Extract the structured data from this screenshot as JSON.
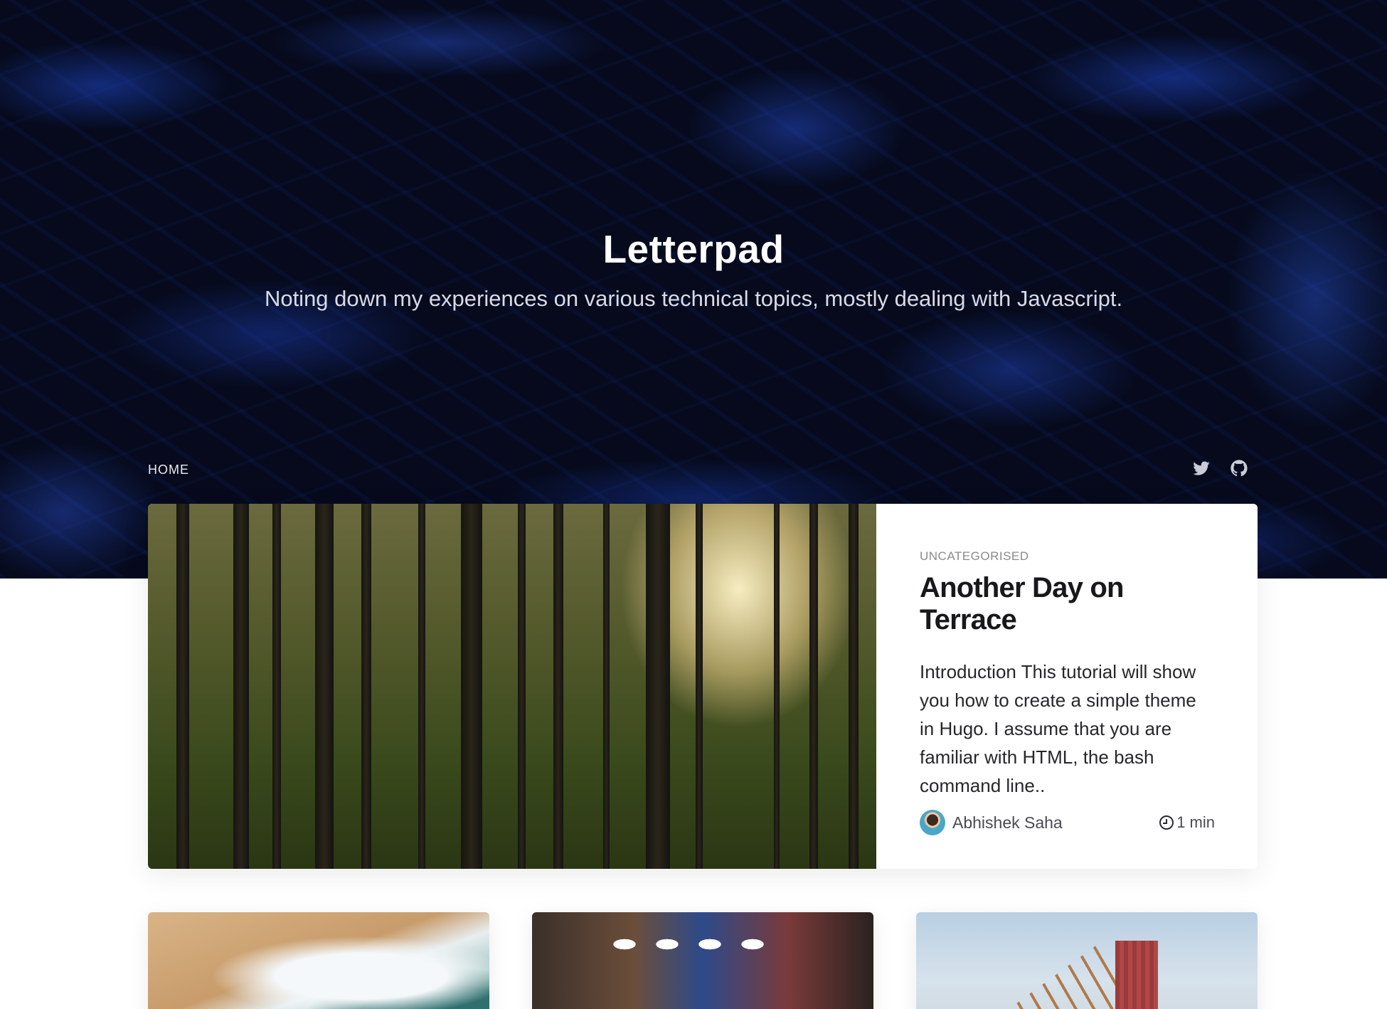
{
  "site": {
    "title": "Letterpad",
    "tagline": "Noting down my experiences on various technical topics, mostly dealing with Javascript."
  },
  "nav": {
    "home_label": "HOME",
    "social": [
      {
        "name": "twitter-icon"
      },
      {
        "name": "github-icon"
      }
    ]
  },
  "featured_post": {
    "category": "UNCATEGORISED",
    "title": "Another Day on Terrace",
    "excerpt": "Introduction This tutorial will show you how to create a simple theme in Hugo. I assume that you are familiar with HTML, the bash command line..",
    "author": "Abhishek Saha",
    "read_time": "1 min",
    "image": "forest-photo"
  },
  "posts": [
    {
      "image": "beach-waves-photo"
    },
    {
      "image": "clothing-store-photo"
    },
    {
      "image": "roof-construction-photo"
    }
  ],
  "colors": {
    "hero_background": "#060a1c",
    "accent_blue": "#1e46c8",
    "title_text": "#17181c"
  }
}
